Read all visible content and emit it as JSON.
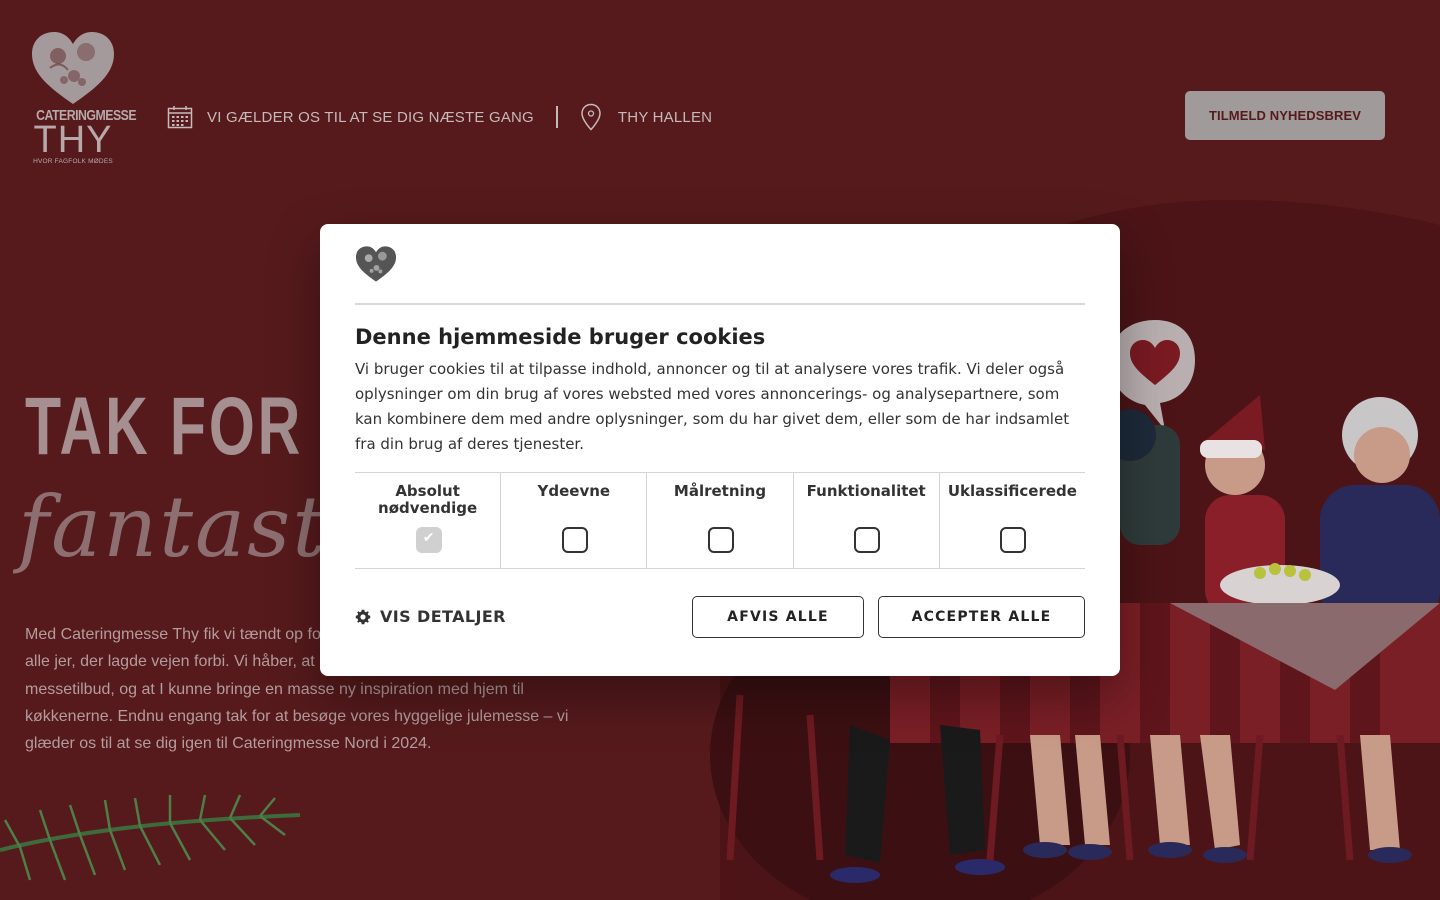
{
  "header": {
    "logo": {
      "name": "CATERINGMESSE",
      "name2": "THY",
      "tagline": "HVOR FAGFOLK MØDES"
    },
    "date_text": "VI GÆLDER OS TIL AT SE DIG NÆSTE GANG",
    "location_text": "THY HALLEN",
    "newsletter_button": "TILMELD NYHEDSBREV"
  },
  "hero": {
    "title": "TAK FOR EN",
    "script": "fantastisk messe",
    "text": "Med Cateringmesse Thy fik vi tændt op for julehyggen, og vi vil gerne sige tak til alle jer, der lagde vejen forbi. Vi håber, at I har fået smagsprøver og gode messetilbud, og at I kunne bringe en masse ny inspiration med hjem til køkkenerne. Endnu engang tak for at besøge vores hyggelige julemesse – vi glæder os til at se dig igen til Cateringmesse Nord i 2024."
  },
  "cookie_dialog": {
    "title": "Denne hjemmeside bruger cookies",
    "body": "Vi bruger cookies til at tilpasse indhold, annoncer og til at analysere vores trafik. Vi deler også oplysninger om din brug af vores websted med vores annoncerings- og analysepartnere, som kan kombinere dem med andre oplysninger, som du har givet dem, eller som de har indsamlet fra din brug af deres tjenester.",
    "categories": [
      {
        "label": "Absolut nødvendige",
        "checked": true,
        "disabled": true
      },
      {
        "label": "Ydeevne",
        "checked": false
      },
      {
        "label": "Målretning",
        "checked": false
      },
      {
        "label": "Funktionalitet",
        "checked": false
      },
      {
        "label": "Uklassificerede",
        "checked": false
      }
    ],
    "details_label": "VIS DETALJER",
    "reject_label": "AFVIS ALLE",
    "accept_label": "ACCEPTER ALLE"
  },
  "colors": {
    "background": "#561a1c",
    "accent": "#a09a9b",
    "dialog": "#ffffff"
  },
  "icons": [
    "calendar-icon",
    "location-pin-icon",
    "gear-icon",
    "heart-logo-icon"
  ]
}
